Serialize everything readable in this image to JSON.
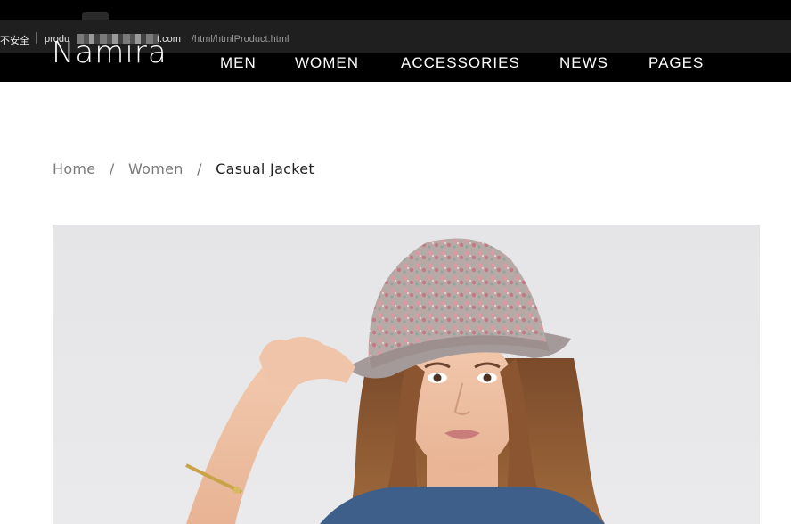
{
  "browser": {
    "security_label": "不安全",
    "url_host": "produ",
    "url_domain": "t.com",
    "url_path": "/html/htmlProduct.html"
  },
  "site": {
    "brand": "Namira",
    "nav": [
      "MEN",
      "WOMEN",
      "ACCESSORIES",
      "NEWS",
      "PAGES"
    ]
  },
  "breadcrumb": {
    "home": "Home",
    "category": "Women",
    "current": "Casual Jacket",
    "separator": "/"
  },
  "product": {
    "image_alt": "product-photo"
  },
  "colors": {
    "nav_bg": "#000000",
    "nav_text": "#ffffff",
    "breadcrumb_link": "#7a7a7a",
    "breadcrumb_current": "#222222"
  }
}
